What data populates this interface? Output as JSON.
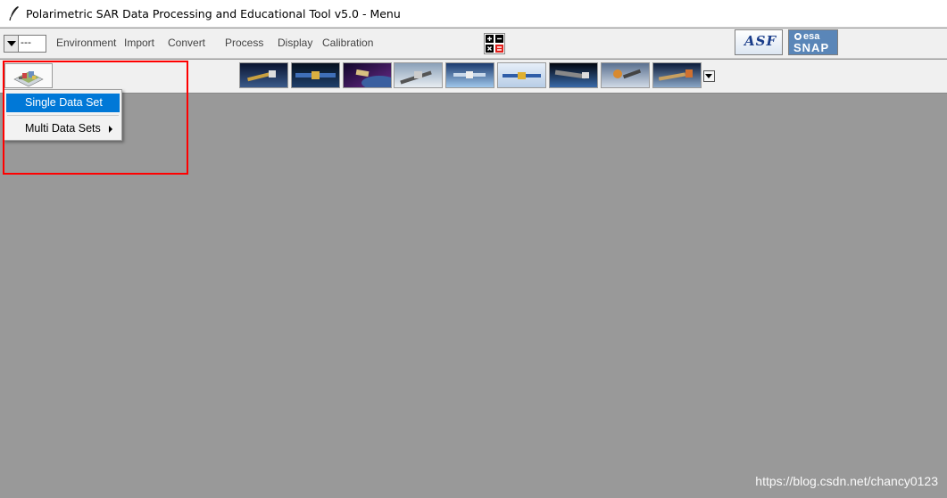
{
  "window": {
    "title": "Polarimetric SAR Data Processing and Educational Tool v5.0 - Menu",
    "app_icon": "feather-pen-icon"
  },
  "menubar": {
    "combo_value": "---",
    "items": [
      {
        "label": "Environment"
      },
      {
        "label": "Import"
      },
      {
        "label": "Convert"
      },
      {
        "label": "Process"
      },
      {
        "label": "Display"
      },
      {
        "label": "Calibration"
      }
    ],
    "calculator_icon": "calculator-icon",
    "logos": {
      "asf": "ASF",
      "esa": "esa",
      "snap": "SNAP"
    }
  },
  "toolbar": {
    "main_icon": "data-set-icon",
    "satellites": [
      "satellite-1-icon",
      "satellite-2-icon",
      "satellite-3-icon",
      "satellite-4-icon",
      "satellite-5-icon",
      "satellite-6-icon",
      "satellite-7-icon",
      "satellite-8-icon",
      "satellite-9-icon"
    ],
    "more_icon": "chevron-down-icon"
  },
  "popup_menu": {
    "items": [
      {
        "label": "Single Data Set",
        "selected": true
      },
      {
        "label": "Multi Data Sets",
        "has_submenu": true
      }
    ]
  },
  "watermark": "https://blog.csdn.net/chancy0123",
  "colors": {
    "workspace": "#999999",
    "selection": "#0078d7",
    "highlight": "#ff0000"
  }
}
